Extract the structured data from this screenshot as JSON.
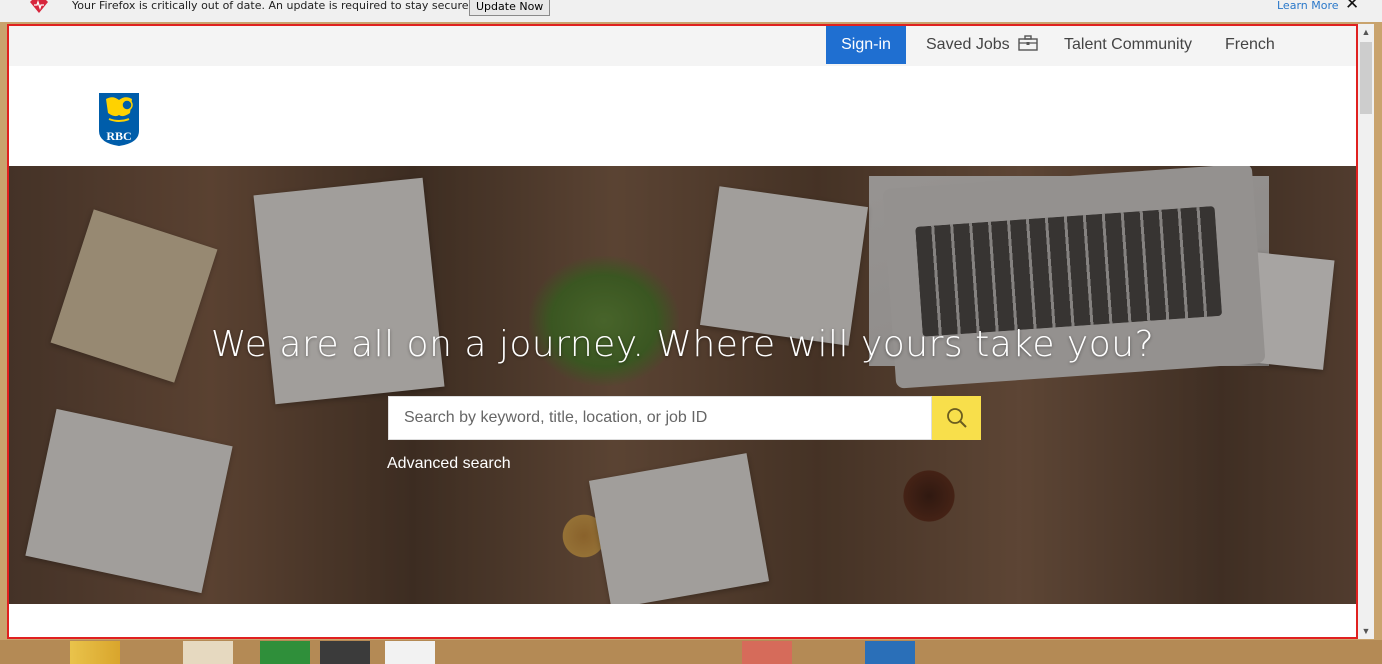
{
  "update_bar": {
    "message": "Your Firefox is critically out of date. An update is required to stay secure.",
    "button_label": "Update Now",
    "learn_more": "Learn More",
    "close_glyph": "✕"
  },
  "nav": {
    "signin": "Sign-in",
    "saved_jobs": "Saved Jobs",
    "talent_community": "Talent Community",
    "language": "French"
  },
  "logo_text": "RBC",
  "hero": {
    "title": "We are all on a journey. Where will yours take you?",
    "search_placeholder": "Search by keyword, title, location, or job ID",
    "advanced_search": "Advanced search"
  },
  "colors": {
    "signin_bg": "#1f6fd1",
    "search_button": "#f8df4b",
    "frame_border": "#e0201f",
    "rbc_blue": "#005daa",
    "rbc_yellow": "#ffd200"
  },
  "icons": [
    "firefox-alert-icon",
    "briefcase-icon",
    "rbc-logo",
    "search-icon",
    "close-icon"
  ]
}
